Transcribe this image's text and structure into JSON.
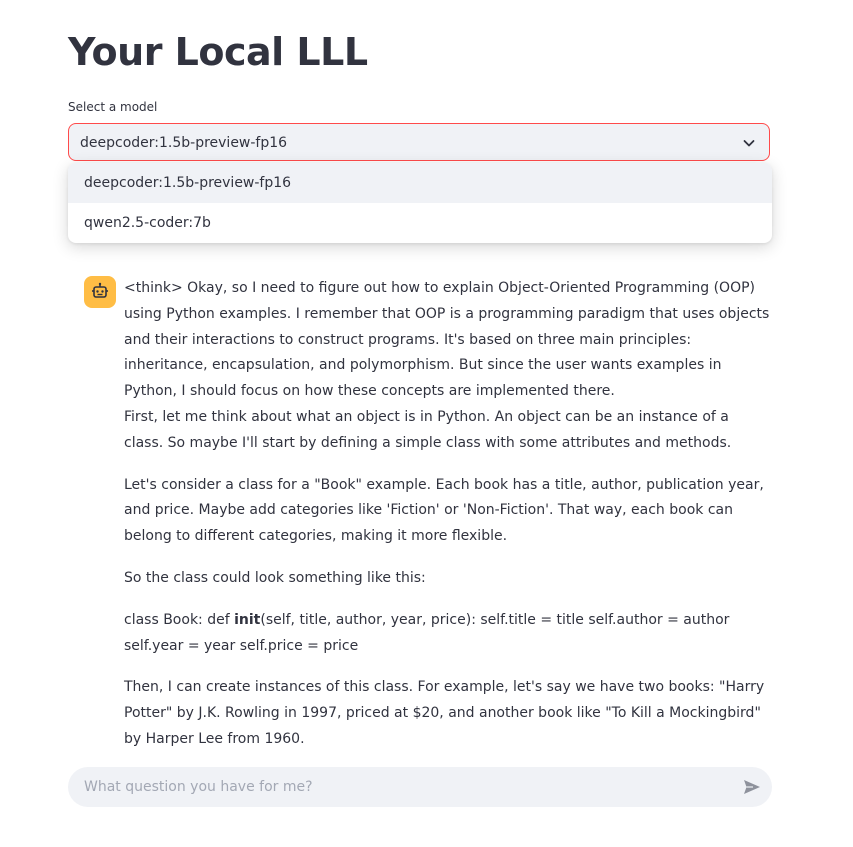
{
  "header": {
    "title": "Your Local LLL"
  },
  "model_select": {
    "label": "Select a model",
    "selected": "deepcoder:1.5b-preview-fp16",
    "options": [
      "deepcoder:1.5b-preview-fp16",
      "qwen2.5-coder:7b"
    ]
  },
  "message": {
    "avatar_icon": "robot-icon",
    "p1_a": "<think> Okay, so I need to figure out how to explain Object-Oriented Programming (OOP) using Python examples. I remember that OOP is a programming paradigm that uses objects and their interactions to construct programs. It's based on three main principles: inheritance, encapsulation, and polymorphism. But since the user wants examples in Python, I should focus on how these concepts are implemented there.",
    "p1_b": "First, let me think about what an object is in Python. An object can be an instance of a class. So maybe I'll start by defining a simple class with some attributes and methods.",
    "p2": "Let's consider a class for a \"Book\" example. Each book has a title, author, publication year, and price. Maybe add categories like 'Fiction' or 'Non-Fiction'. That way, each book can belong to different categories, making it more flexible.",
    "p3": "So the class could look something like this:",
    "p4_pre": "class Book: def ",
    "p4_bold": "init",
    "p4_post": "(self, title, author, year, price): self.title = title self.author = author self.year = year self.price = price",
    "p5": "Then, I can create instances of this class. For example, let's say we have two books: \"Harry Potter\" by J.K. Rowling in 1997, priced at $20, and another book like \"To Kill a Mockingbird\" by Harper Lee from 1960."
  },
  "chat_input": {
    "placeholder": "What question you have for me?",
    "send_icon": "send-icon"
  },
  "colors": {
    "accent": "#ff4b4b",
    "input_bg": "#f0f2f6",
    "avatar_bg": "#ffbd45",
    "text": "#31333f"
  }
}
